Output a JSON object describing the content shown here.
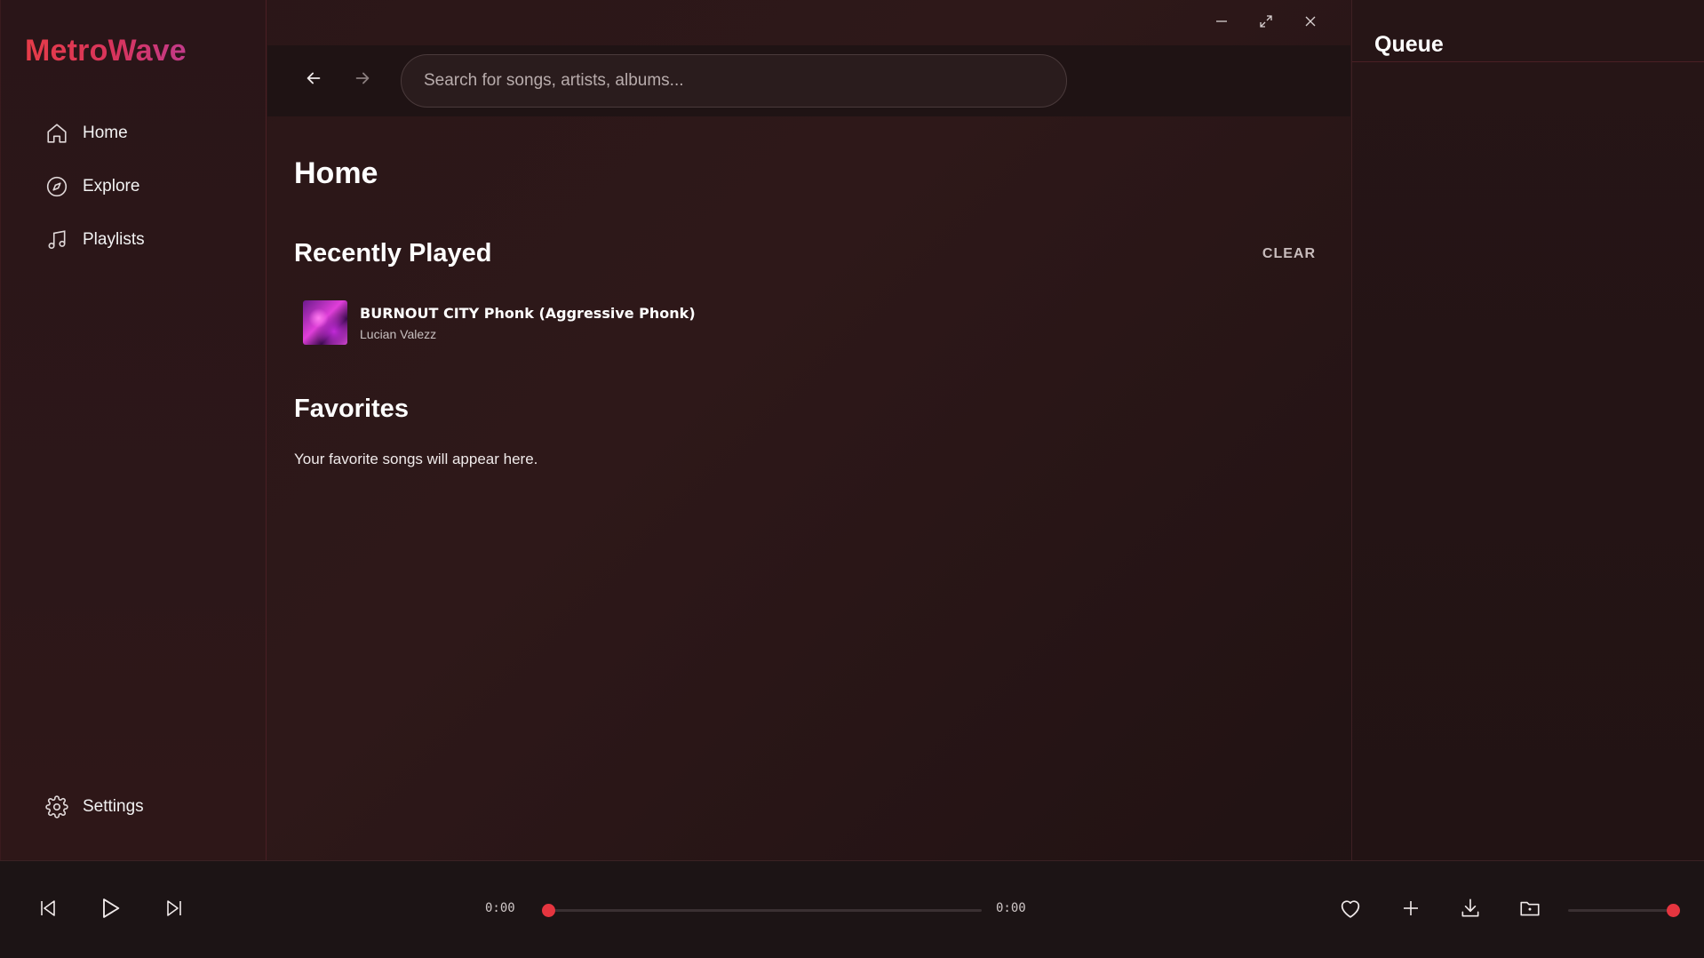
{
  "app": {
    "brand": "MetroWave"
  },
  "sidebar": {
    "items": [
      {
        "label": "Home",
        "icon": "home-icon"
      },
      {
        "label": "Explore",
        "icon": "compass-icon"
      },
      {
        "label": "Playlists",
        "icon": "music-note-icon"
      }
    ],
    "settings_label": "Settings"
  },
  "search": {
    "placeholder": "Search for songs, artists, albums..."
  },
  "main": {
    "page_title": "Home",
    "recently_played": {
      "title": "Recently Played",
      "clear_label": "CLEAR",
      "tracks": [
        {
          "title": "BURNOUT CITY Phonk (Aggressive Phonk)",
          "artist": "Lucian Valezz"
        }
      ]
    },
    "favorites": {
      "title": "Favorites",
      "empty_text": "Your favorite songs will appear here."
    }
  },
  "queue": {
    "title": "Queue"
  },
  "player": {
    "elapsed": "0:00",
    "duration": "0:00",
    "progress": 0,
    "volume": 1.0
  },
  "colors": {
    "accent": "#e5353f",
    "brand_gradient_start": "#e63c48",
    "brand_gradient_end": "#c23a8a",
    "background": "#2a1618"
  }
}
